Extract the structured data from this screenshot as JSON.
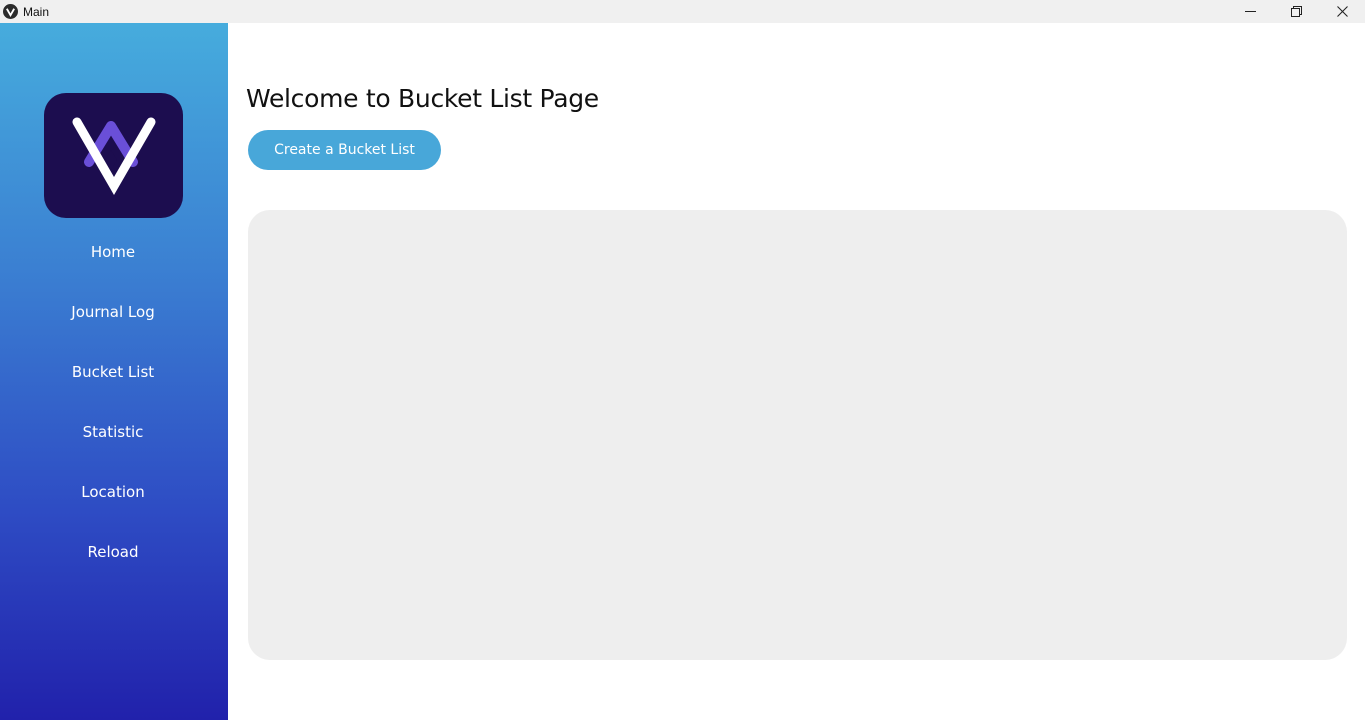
{
  "window": {
    "title": "Main",
    "controls": {
      "minimize_icon": "minimize-icon",
      "restore_icon": "restore-icon",
      "close_icon": "close-icon"
    }
  },
  "sidebar": {
    "logo_icon": "app-logo",
    "items": [
      {
        "label": "Home"
      },
      {
        "label": "Journal Log"
      },
      {
        "label": "Bucket List"
      },
      {
        "label": "Statistic"
      },
      {
        "label": "Location"
      },
      {
        "label": "Reload"
      }
    ]
  },
  "main": {
    "title": "Welcome to Bucket List Page",
    "create_button_label": "Create a Bucket List"
  },
  "colors": {
    "sidebar_top": "#46acdd",
    "sidebar_bottom": "#2121ab",
    "logo_bg": "#1c0d4f",
    "button": "#48a7d9",
    "panel": "#eeeeee"
  }
}
